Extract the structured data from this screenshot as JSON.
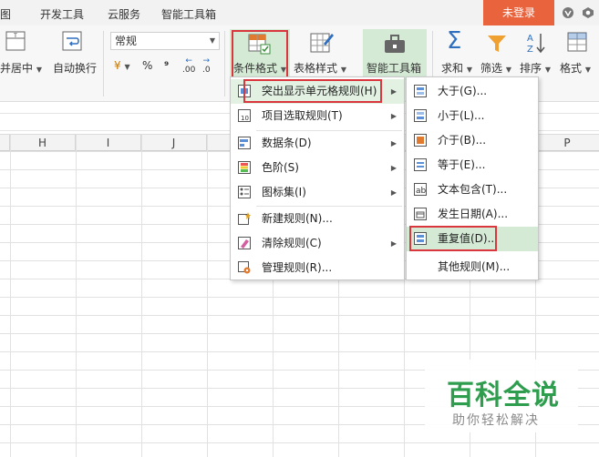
{
  "tabs": [
    "图",
    "开发工具",
    "云服务",
    "智能工具箱"
  ],
  "login_label": "未登录",
  "ribbon": {
    "merge_center": "并居中",
    "auto_wrap": "自动换行",
    "number_format": "常规",
    "currency_symbol": "¥",
    "percent": "%",
    "comma": "⁹",
    "dec_increase": ".00",
    "dec_decrease": ".0",
    "cond_format": "条件格式",
    "table_style": "表格样式",
    "smart_toolbox": "智能工具箱",
    "sum": "求和",
    "filter": "筛选",
    "sort": "排序",
    "format": "格式"
  },
  "columns": [
    "H",
    "I",
    "J",
    "",
    "",
    "",
    "",
    "",
    "",
    "P"
  ],
  "main_menu": {
    "items": [
      {
        "icon": "highlight-cells-icon",
        "label": "突出显示单元格规则(H)",
        "has_submenu": true
      },
      {
        "icon": "top-bottom-icon",
        "label": "项目选取规则(T)",
        "has_submenu": true
      },
      {
        "icon": "data-bars-icon",
        "label": "数据条(D)",
        "has_submenu": true
      },
      {
        "icon": "color-scale-icon",
        "label": "色阶(S)",
        "has_submenu": true
      },
      {
        "icon": "icon-set-icon",
        "label": "图标集(I)",
        "has_submenu": true
      },
      {
        "icon": "new-rule-icon",
        "label": "新建规则(N)...",
        "has_submenu": false
      },
      {
        "icon": "clear-rule-icon",
        "label": "清除规则(C)",
        "has_submenu": true
      },
      {
        "icon": "manage-rule-icon",
        "label": "管理规则(R)...",
        "has_submenu": false
      }
    ]
  },
  "sub_menu": {
    "items": [
      {
        "icon": "greater-than-icon",
        "label": "大于(G)..."
      },
      {
        "icon": "less-than-icon",
        "label": "小于(L)..."
      },
      {
        "icon": "between-icon",
        "label": "介于(B)..."
      },
      {
        "icon": "equal-to-icon",
        "label": "等于(E)..."
      },
      {
        "icon": "text-contains-icon",
        "label": "文本包含(T)..."
      },
      {
        "icon": "date-occurring-icon",
        "label": "发生日期(A)..."
      },
      {
        "icon": "duplicate-values-icon",
        "label": "重复值(D)..."
      },
      {
        "icon": "",
        "label": "其他规则(M)..."
      }
    ]
  },
  "watermark": {
    "title": "百科全说",
    "subtitle": "助你轻松解决"
  },
  "colors": {
    "login_bg": "#e9633c",
    "highlight_red": "#d9363e",
    "hover_green": "#d4ead5",
    "watermark_green": "#2e9e4e"
  }
}
